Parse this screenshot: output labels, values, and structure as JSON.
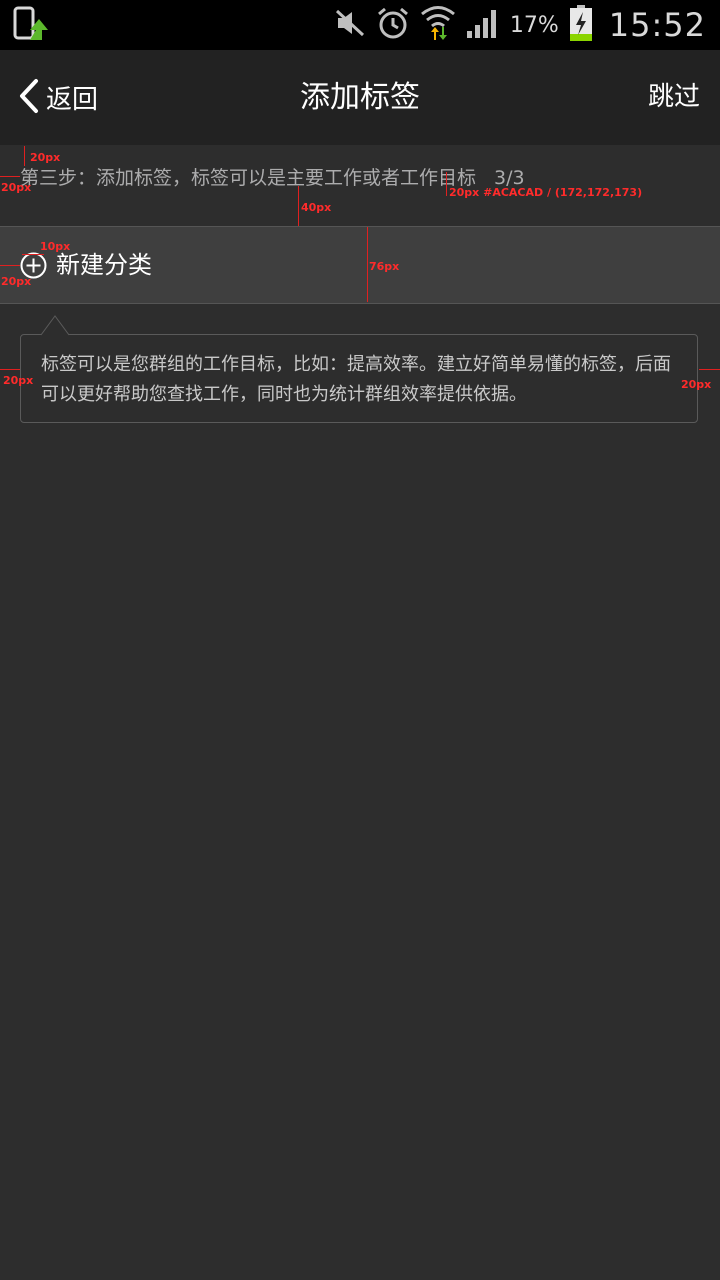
{
  "status_bar": {
    "icons": [
      "upload-notification-icon",
      "mute-icon",
      "alarm-icon",
      "wifi-icon",
      "signal-icon",
      "battery-charging-icon"
    ],
    "battery_percent": "17%",
    "time": "15:52"
  },
  "nav": {
    "back_label": "返回",
    "title": "添加标签",
    "skip_label": "跳过"
  },
  "step": {
    "text": "第三步：添加标签，标签可以是主要工作或者工作目标",
    "counter": "3/3"
  },
  "new_category": {
    "label": "新建分类",
    "icon": "plus-circle-icon"
  },
  "tooltip": {
    "text": "标签可以是您群组的工作目标，比如：提高效率。建立好简单易懂的标签，后面可以更好帮助您查找工作，同时也为统计群组效率提供依据。"
  },
  "annotations": {
    "a1": "20px",
    "a2": "20px",
    "a3": "40px",
    "a4": "20px #ACACAD / (172,172,173)",
    "a5": "10px",
    "a6": "20px",
    "a7": "76px",
    "a8": "20px",
    "a9": "20px"
  },
  "colors": {
    "step_text": "#ACACAD",
    "background": "#2d2d2d",
    "annotation": "#ff2b2b"
  }
}
